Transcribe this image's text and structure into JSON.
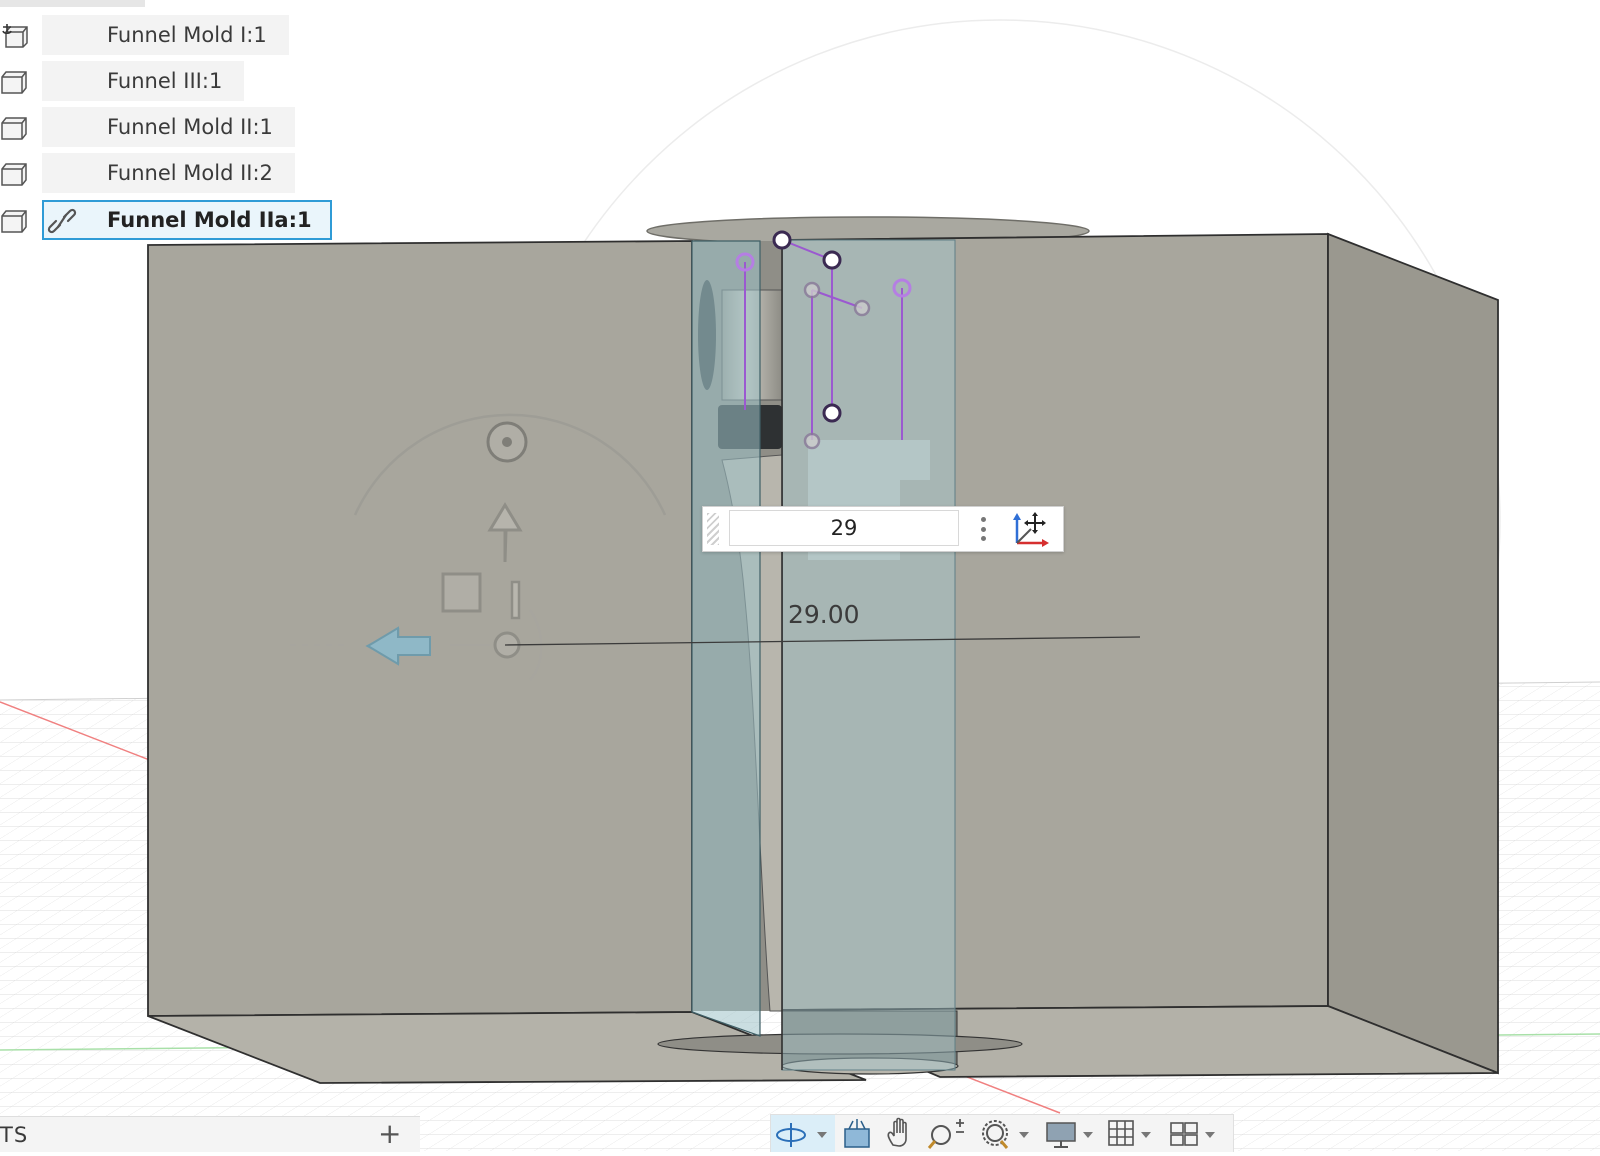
{
  "browser": {
    "items": [
      {
        "label": "Funnel Mold I:1",
        "selected": false,
        "icon": "component-anchor-icon"
      },
      {
        "label": "Funnel III:1",
        "selected": false,
        "icon": "component-box-icon"
      },
      {
        "label": "Funnel Mold II:1",
        "selected": false,
        "icon": "component-box-icon"
      },
      {
        "label": "Funnel Mold II:2",
        "selected": false,
        "icon": "component-box-icon"
      },
      {
        "label": "Funnel Mold IIa:1",
        "selected": true,
        "icon": "component-box-icon"
      }
    ]
  },
  "dimension": {
    "input_value": "29",
    "label": "29.00"
  },
  "bottom_panel": {
    "title": "TS",
    "add": "+"
  },
  "navbar": {
    "buttons": [
      "orbit-icon",
      "look-at-icon",
      "pan-icon",
      "zoom-icon",
      "fit-icon",
      "display-settings-icon",
      "grid-icon",
      "viewports-icon"
    ]
  },
  "colors": {
    "selection": "#2f9bd6",
    "body_gray": "#a8a69d",
    "section_blue": "#9fc2c8",
    "sketch_purple": "#9b59d0"
  }
}
